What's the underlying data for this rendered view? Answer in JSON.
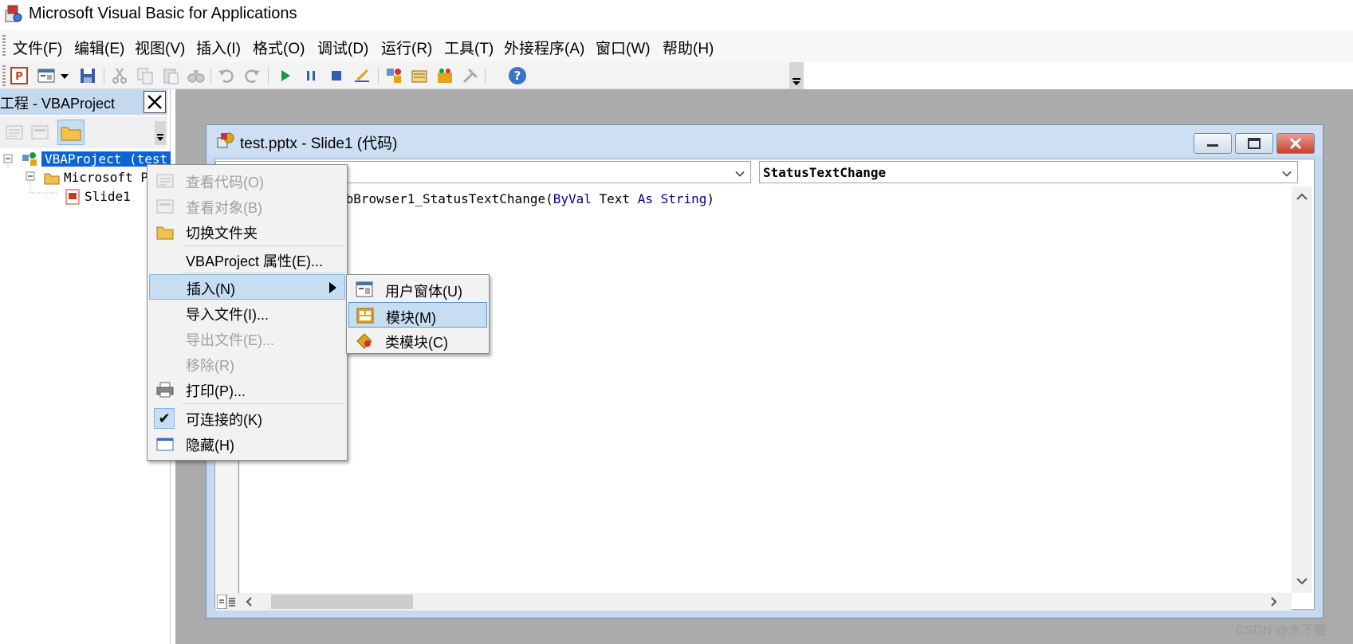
{
  "window": {
    "title": "Microsoft Visual Basic for Applications"
  },
  "menubar": {
    "items": [
      "文件(F)",
      "编辑(E)",
      "视图(V)",
      "插入(I)",
      "格式(O)",
      "调试(D)",
      "运行(R)",
      "工具(T)",
      "外接程序(A)",
      "窗口(W)",
      "帮助(H)"
    ]
  },
  "toolbar": {
    "buttons": [
      "powerpoint-view-icon",
      "insert-userform-icon",
      "dropdown-arrow-icon",
      "save-icon",
      "cut-icon",
      "copy-icon",
      "paste-icon",
      "find-icon",
      "undo-icon",
      "redo-icon",
      "run-icon",
      "break-icon",
      "reset-icon",
      "design-mode-icon",
      "project-explorer-icon",
      "properties-icon",
      "object-browser-icon",
      "toolbox-icon",
      "help-icon"
    ]
  },
  "project_panel": {
    "title": "工程 - VBAProject",
    "tree": {
      "root": "VBAProject (test",
      "folder": "Microsoft P",
      "slide": "Slide1"
    }
  },
  "code_window": {
    "title": "test.pptx - Slide1 (代码)",
    "object_combo": "",
    "procedure_combo": "StatusTextChange",
    "code_line": {
      "prefix": "ebBrowser1_StatusTextChange(",
      "kw1": "ByVal",
      "mid": " Text ",
      "kw2": "As",
      "sp": " ",
      "kw3": "String",
      "suffix": ")"
    }
  },
  "context_menu": {
    "items": [
      {
        "label": "查看代码(O)",
        "disabled": true
      },
      {
        "label": "查看对象(B)",
        "disabled": true
      },
      {
        "label": "切换文件夹",
        "disabled": false
      },
      {
        "label": "VBAProject 属性(E)...",
        "disabled": false
      },
      {
        "label": "插入(N)",
        "disabled": false,
        "highlighted": true
      },
      {
        "label": "导入文件(I)...",
        "disabled": false
      },
      {
        "label": "导出文件(E)...",
        "disabled": true
      },
      {
        "label": "移除(R)",
        "disabled": true
      },
      {
        "label": "打印(P)...",
        "disabled": false
      },
      {
        "label": "可连接的(K)",
        "disabled": false,
        "checked": true
      },
      {
        "label": "隐藏(H)",
        "disabled": false
      }
    ]
  },
  "submenu": {
    "items": [
      {
        "label": "用户窗体(U)"
      },
      {
        "label": "模块(M)",
        "highlighted": true
      },
      {
        "label": "类模块(C)"
      }
    ]
  },
  "watermark": "CSDN @木下瞳"
}
